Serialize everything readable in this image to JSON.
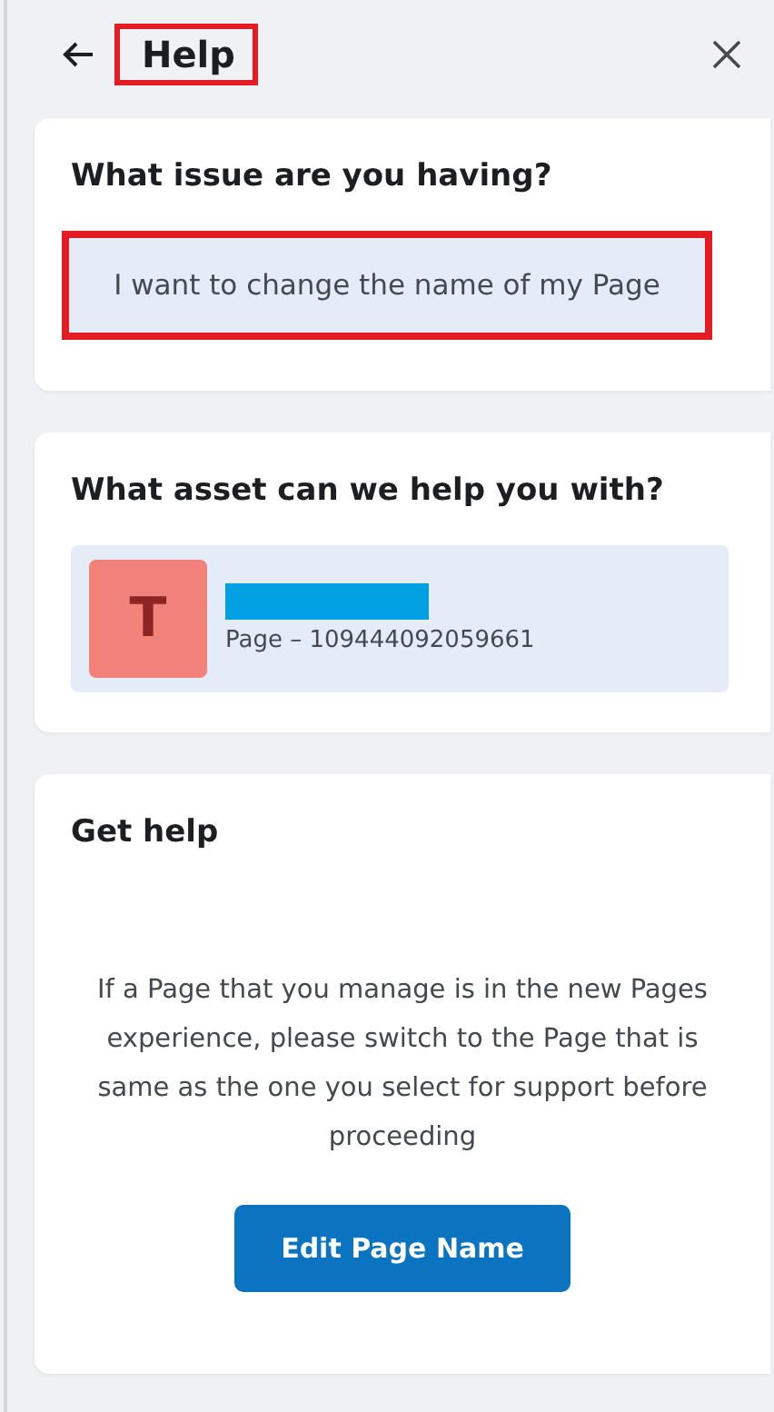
{
  "header": {
    "title": "Help",
    "title_highlighted": true
  },
  "issue_card": {
    "heading": "What issue are you having?",
    "issue": "I want to change the name of my Page",
    "issue_highlighted": true
  },
  "asset_card": {
    "heading": "What asset can we help you with?",
    "asset": {
      "initial": "T",
      "name_redacted": true,
      "subtitle": "Page – 109444092059661"
    }
  },
  "help_card": {
    "heading": "Get help",
    "message": "If a Page that you manage is in the new Pages experience, please switch to the Page that is same as the one you select for support before proceeding",
    "button": "Edit Page Name"
  }
}
